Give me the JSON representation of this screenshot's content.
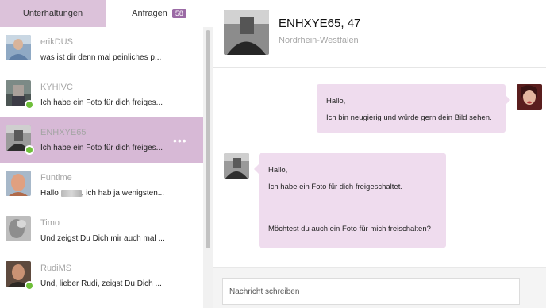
{
  "tabs": {
    "conversations": "Unterhaltungen",
    "requests": "Anfragen",
    "requests_count": "58"
  },
  "conversations": [
    {
      "name": "erikDUS",
      "preview": "was ist dir denn mal peinliches p...",
      "online": false
    },
    {
      "name": "KYHIVC",
      "preview": "Ich habe ein Foto für dich freiges...",
      "online": true
    },
    {
      "name": "ENHXYE65",
      "preview": "Ich habe ein Foto für dich freiges...",
      "online": true,
      "active": true,
      "more": "•••"
    },
    {
      "name": "Funtime",
      "preview_start": "Hallo",
      "preview_end": ", ich hab ja wenigsten...",
      "online": false
    },
    {
      "name": "Timo",
      "preview": "Und zeigst Du Dich mir auch mal ...",
      "online": false
    },
    {
      "name": "RudiMS",
      "preview": "Und, lieber Rudi, zeigst Du Dich ...",
      "online": true
    }
  ],
  "chat": {
    "title": "ENHXYE65, 47",
    "location": "Nordrhein-Westfalen",
    "messages": [
      {
        "side": "outgoing",
        "lines": [
          "Hallo,",
          "Ich bin neugierig und würde gern dein Bild sehen."
        ]
      },
      {
        "side": "incoming",
        "lines": [
          "Hallo,",
          "Ich habe ein Foto für dich freigeschaltet.",
          "Möchtest du auch ein Foto für mich freischalten?"
        ]
      }
    ]
  },
  "compose": {
    "placeholder": "Nachricht schreiben"
  },
  "colors": {
    "accent": "#d7b9d6",
    "tab_active": "#dcc2da",
    "badge": "#9b6aa5",
    "bubble": "#efdcee",
    "online": "#6fbf3a"
  }
}
